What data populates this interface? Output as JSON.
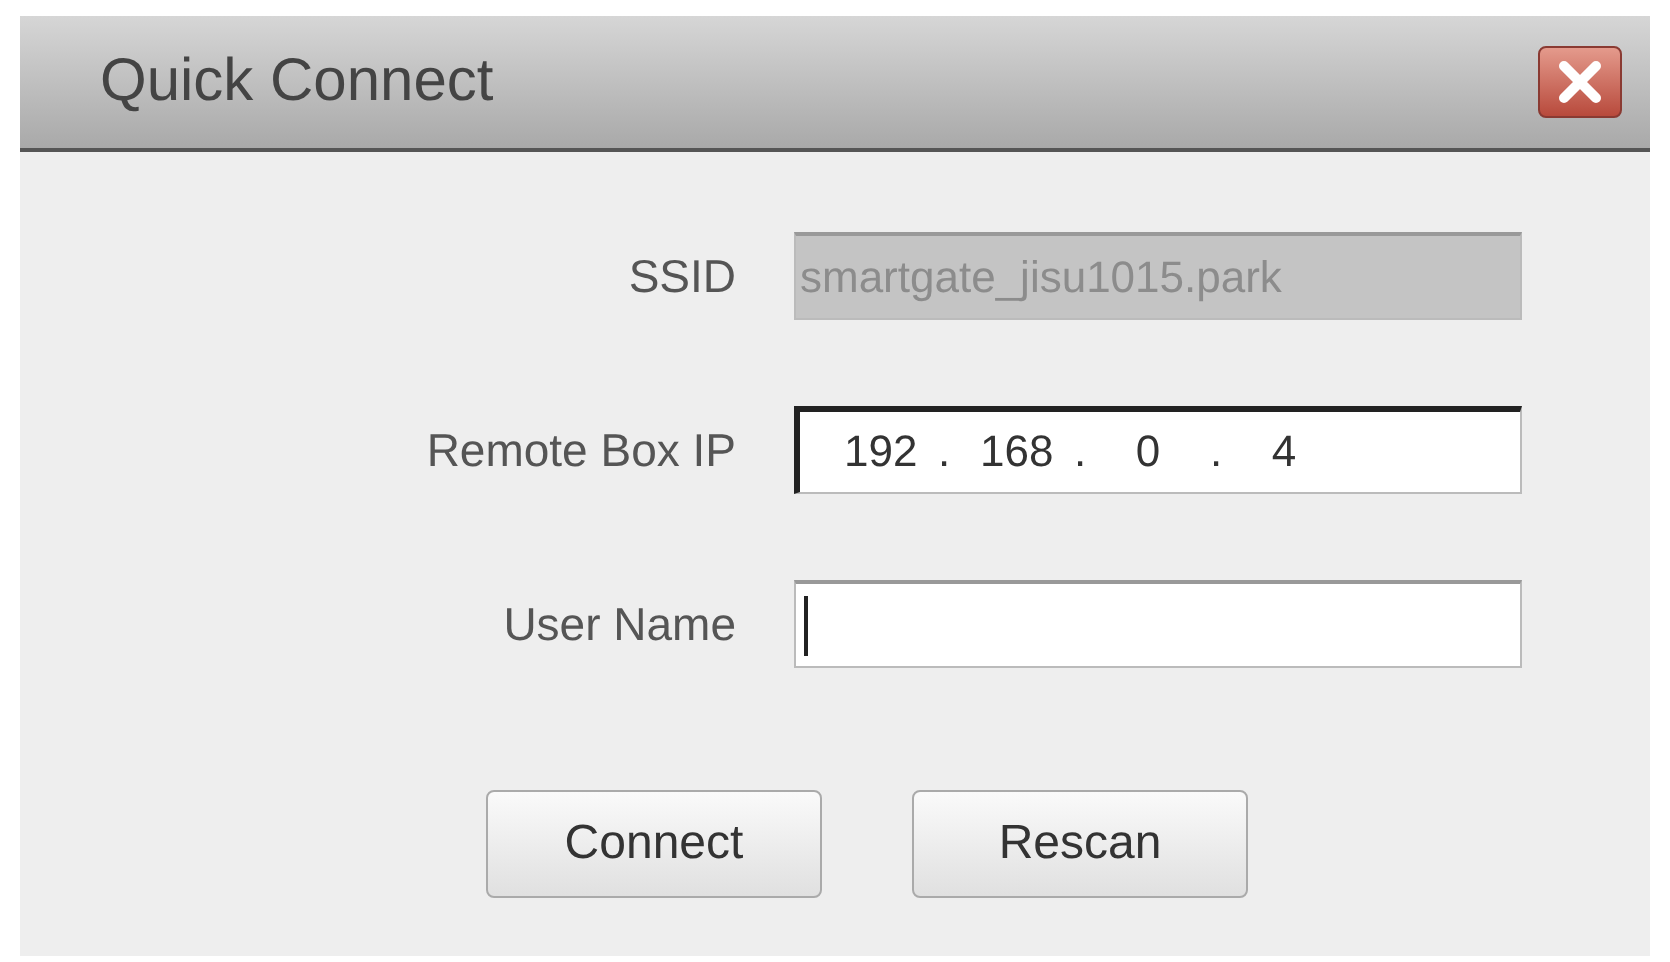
{
  "window": {
    "title": "Quick Connect"
  },
  "fields": [
    {
      "label": "SSID",
      "kind": "text",
      "disabled": true,
      "value": "smartgate_jisu1015.park"
    },
    {
      "label": "Remote Box IP",
      "kind": "ip",
      "disabled": false,
      "octets": [
        "192",
        "168",
        "0",
        "4"
      ],
      "separator": "."
    },
    {
      "label": "User Name",
      "kind": "text",
      "disabled": false,
      "focused": true
    }
  ],
  "buttons": [
    "Connect",
    "Rescan"
  ]
}
